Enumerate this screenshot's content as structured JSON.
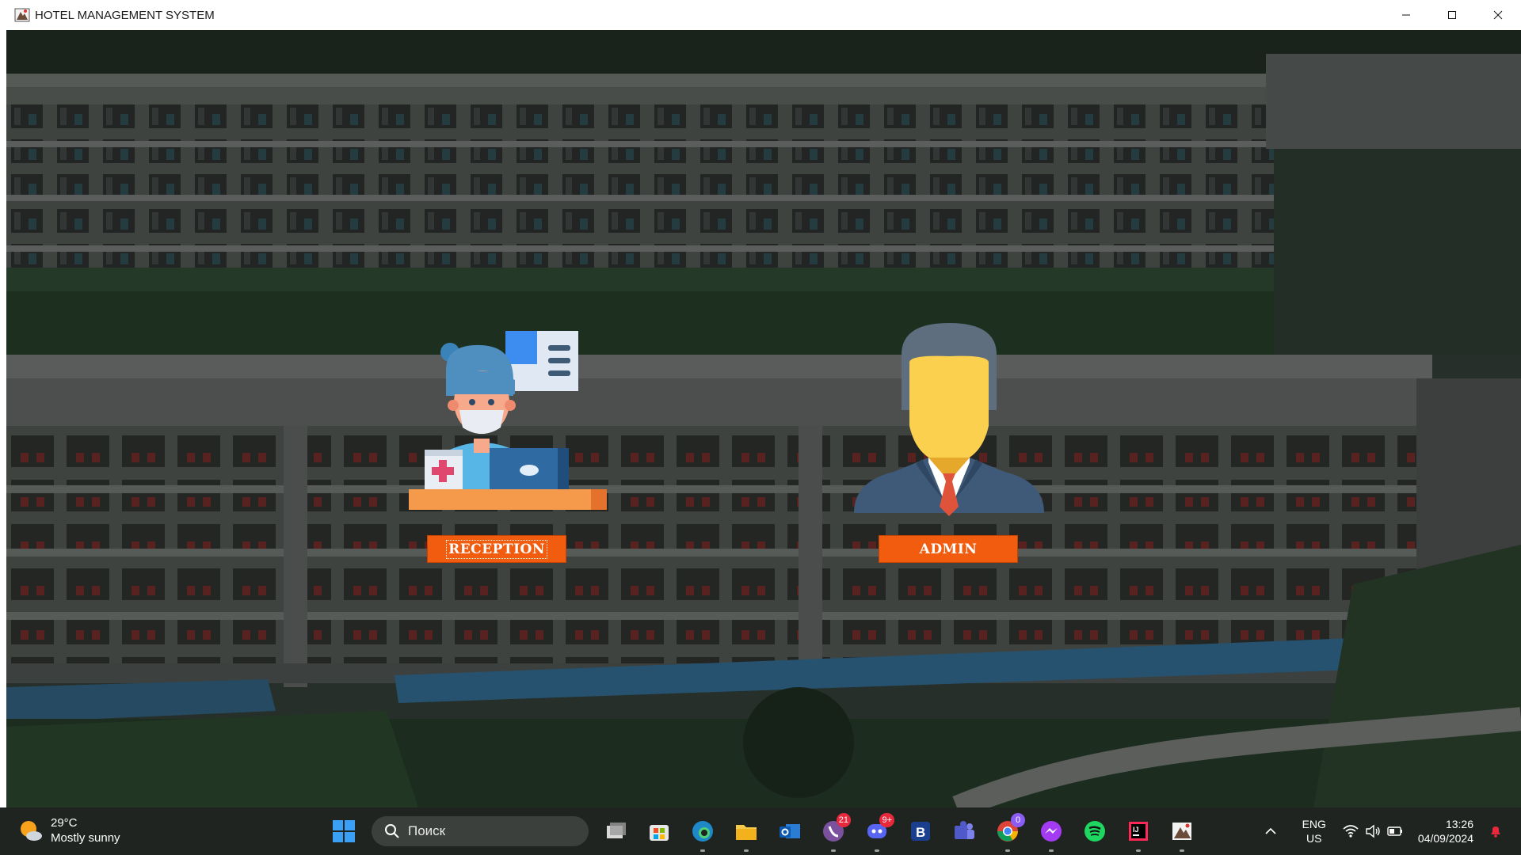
{
  "window": {
    "title": "HOTEL MANAGEMENT SYSTEM",
    "controls": [
      "minimize",
      "maximize",
      "close"
    ]
  },
  "roles": [
    {
      "id": "reception",
      "label": "RECEPTION",
      "focused": true
    },
    {
      "id": "admin",
      "label": "ADMIN",
      "focused": false
    }
  ],
  "colors": {
    "accent": "#f25c0e",
    "taskbar": "#1f2421"
  },
  "taskbar": {
    "weather": {
      "temperature": "29°C",
      "condition": "Mostly sunny"
    },
    "search_placeholder": "Поиск",
    "apps": [
      {
        "name": "task-view",
        "badge": ""
      },
      {
        "name": "microsoft-store",
        "badge": ""
      },
      {
        "name": "edge",
        "badge": ""
      },
      {
        "name": "file-explorer",
        "badge": ""
      },
      {
        "name": "outlook",
        "badge": ""
      },
      {
        "name": "viber",
        "badge": "21"
      },
      {
        "name": "discord",
        "badge": "9+"
      },
      {
        "name": "b-app",
        "badge": ""
      },
      {
        "name": "teams",
        "badge": ""
      },
      {
        "name": "chrome",
        "badge": "0"
      },
      {
        "name": "messenger",
        "badge": ""
      },
      {
        "name": "spotify",
        "badge": ""
      },
      {
        "name": "intellij",
        "badge": ""
      },
      {
        "name": "java-app",
        "badge": ""
      }
    ],
    "language": {
      "line1": "ENG",
      "line2": "US"
    },
    "clock": {
      "time": "13:26",
      "date": "04/09/2024"
    }
  }
}
